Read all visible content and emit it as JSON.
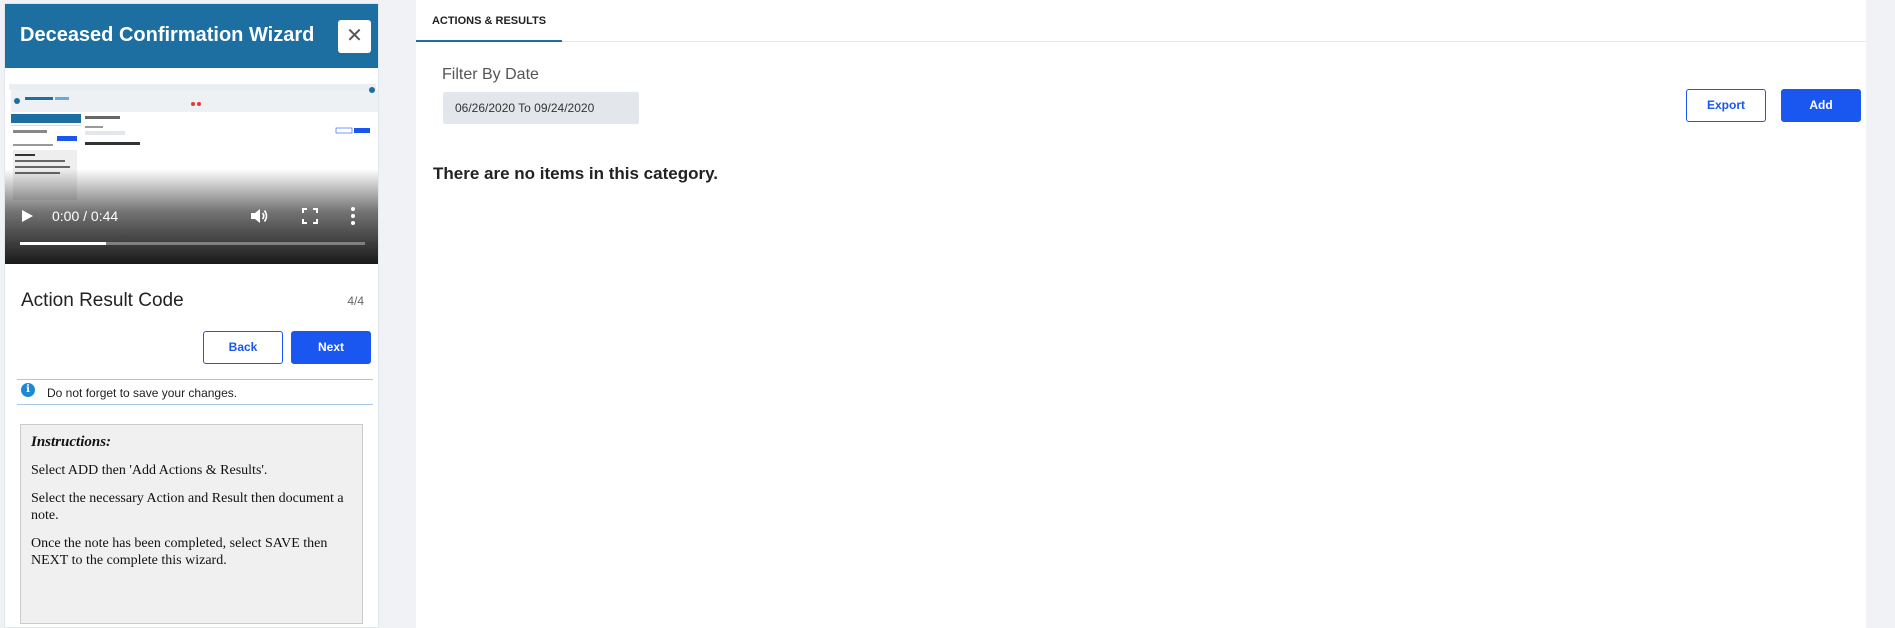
{
  "wizard": {
    "title": "Deceased Confirmation Wizard",
    "close_symbol": "✕",
    "video": {
      "time": "0:00 / 0:44",
      "progress": 0.25
    },
    "step_title": "Action Result Code",
    "step_count": "4/4",
    "back_label": "Back",
    "next_label": "Next",
    "notice_icon": "i",
    "notice_text": "Do not forget to save your changes.",
    "instructions": {
      "title": "Instructions:",
      "lines": [
        "Select ADD then 'Add Actions & Results'.",
        "Select the necessary Action and Result then document a note.",
        "Once the note has been completed, select SAVE then NEXT to the complete this wizard."
      ]
    }
  },
  "main": {
    "tab_label": "ACTIONS & RESULTS",
    "filter_label": "Filter By Date",
    "date_range": "06/26/2020 To 09/24/2020",
    "export_label": "Export",
    "add_label": "Add",
    "empty_message": "There are no items in this category."
  },
  "colors": {
    "header": "#1d6fa1",
    "primary": "#1a56f0",
    "info": "#1e88d8"
  },
  "icons": [
    "close-icon",
    "play-icon",
    "volume-icon",
    "fullscreen-icon",
    "more-vertical-icon",
    "info-icon"
  ]
}
